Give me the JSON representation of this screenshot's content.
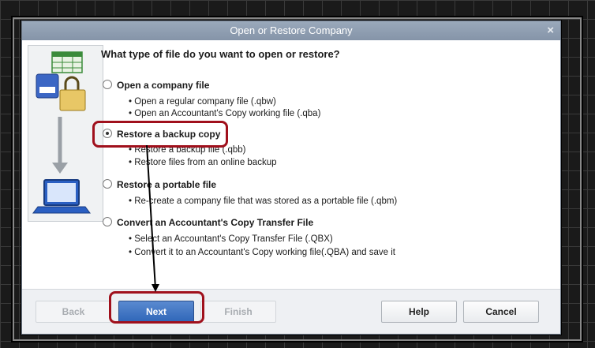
{
  "dialog": {
    "title": "Open or Restore Company",
    "close_glyph": "×",
    "question": "What type of file do you want to open or restore?",
    "options": [
      {
        "label": "Open a company file",
        "selected": false,
        "bullets": [
          "Open a regular company file (.qbw)",
          "Open an Accountant's Copy working file (.qba)"
        ]
      },
      {
        "label": "Restore a backup copy",
        "selected": true,
        "bullets": [
          "Restore a backup file (.qbb)",
          "Restore files from an online backup"
        ]
      },
      {
        "label": "Restore a portable file",
        "selected": false,
        "bullets": [
          "Re-create a company file that was stored as a portable file (.qbm)"
        ]
      },
      {
        "label": "Convert an Accountant's Copy Transfer File",
        "selected": false,
        "bullets": [
          "Select an Accountant's Copy Transfer File (.QBX)",
          "Convert it to an Accountant's Copy working file(.QBA) and save it"
        ]
      }
    ],
    "buttons": {
      "back": "Back",
      "next": "Next",
      "finish": "Finish",
      "help": "Help",
      "cancel": "Cancel"
    }
  },
  "colors": {
    "accent": "#2f66b8",
    "highlight": "#a0101c",
    "titlebar": "#8f9db0"
  },
  "icons": [
    "spreadsheet-icon",
    "database-icon",
    "lock-icon",
    "arrow-down-icon",
    "laptop-icon"
  ]
}
